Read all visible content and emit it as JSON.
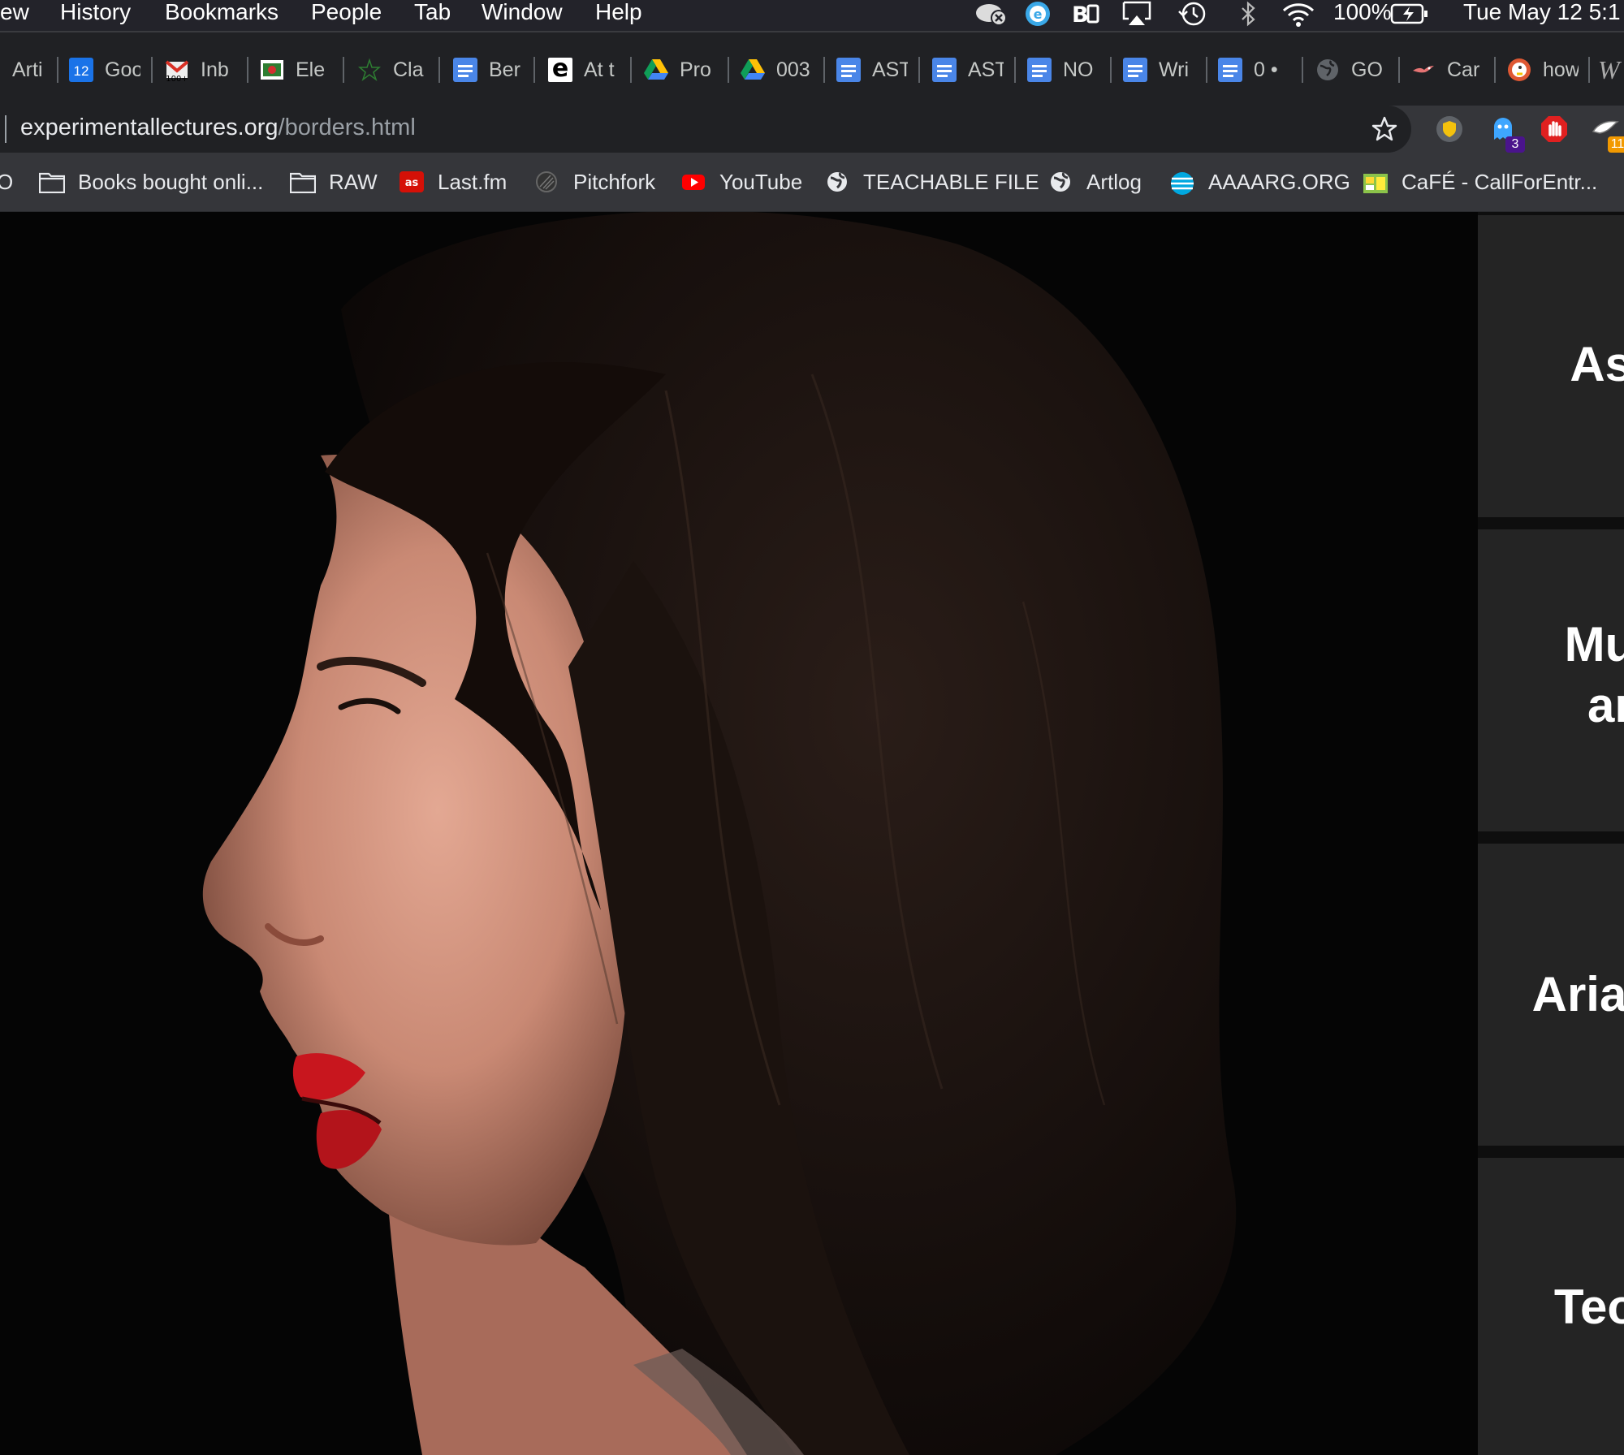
{
  "menubar": {
    "items": [
      "ew",
      "History",
      "Bookmarks",
      "People",
      "Tab",
      "Window",
      "Help"
    ],
    "battery": "100%",
    "clock": "Tue May 12  5:1"
  },
  "tabs": [
    {
      "label": "Arti",
      "icon": "article-icon"
    },
    {
      "label": "Goo",
      "icon": "google-calendar-icon",
      "icon_text": "12"
    },
    {
      "label": "Inb",
      "icon": "gmail-icon"
    },
    {
      "label": "Ele",
      "icon": "electron-icon"
    },
    {
      "label": "Cla",
      "icon": "star-outline-icon"
    },
    {
      "label": "Ber",
      "icon": "google-docs-icon"
    },
    {
      "label": "At t",
      "icon": "e-flux-icon"
    },
    {
      "label": "Pro",
      "icon": "google-drive-icon"
    },
    {
      "label": "003",
      "icon": "google-drive-icon"
    },
    {
      "label": "AST",
      "icon": "google-docs-icon"
    },
    {
      "label": "AST",
      "icon": "google-docs-icon"
    },
    {
      "label": "NO",
      "icon": "google-docs-icon"
    },
    {
      "label": "Wri",
      "icon": "google-docs-icon"
    },
    {
      "label": "0 •",
      "icon": "google-docs-icon"
    },
    {
      "label": "GO",
      "icon": "globe-icon"
    },
    {
      "label": "Car",
      "icon": "bird-icon"
    },
    {
      "label": "how",
      "icon": "duckduckgo-icon"
    }
  ],
  "address": {
    "domain": "experimentallectures.org",
    "path": "/borders.html"
  },
  "extensions": {
    "ghostery_count": "3",
    "last_count": "11"
  },
  "bookmarks": [
    {
      "label": "O",
      "icon": "none"
    },
    {
      "label": "Books bought onli...",
      "icon": "folder-icon"
    },
    {
      "label": "RAW",
      "icon": "folder-icon"
    },
    {
      "label": "Last.fm",
      "icon": "lastfm-icon"
    },
    {
      "label": "Pitchfork",
      "icon": "pitchfork-icon"
    },
    {
      "label": "YouTube",
      "icon": "youtube-icon"
    },
    {
      "label": "TEACHABLE FILE",
      "icon": "globe-icon"
    },
    {
      "label": "Artlog",
      "icon": "globe-icon"
    },
    {
      "label": "AAAARG.ORG",
      "icon": "att-globe-icon"
    },
    {
      "label": "CaFÉ - CallForEntr...",
      "icon": "cafe-icon"
    }
  ],
  "sidebar_cards": [
    {
      "title": "Ash"
    },
    {
      "title": "Muir\nan"
    },
    {
      "title": "Ariana"
    },
    {
      "title": "Teo v"
    }
  ],
  "colors": {
    "menubar": "#23232a",
    "tabstrip": "#202124",
    "toolbar": "#35363a",
    "card": "#242424",
    "lips": "#c8161e"
  }
}
